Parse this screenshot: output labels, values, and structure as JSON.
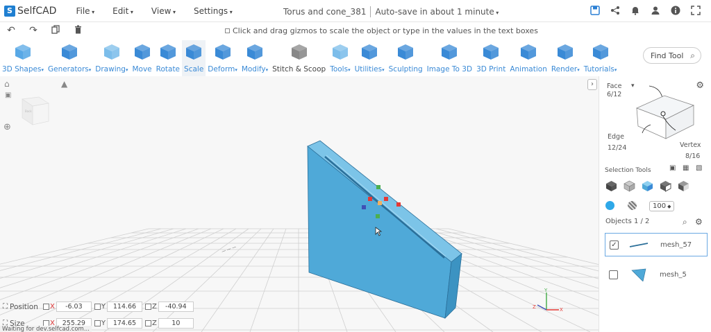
{
  "app": {
    "logo": "SelfCAD",
    "menus": [
      "File",
      "Edit",
      "View",
      "Settings"
    ],
    "doc_title": "Torus and cone_381",
    "autosave": "Auto-save in about 1 minute"
  },
  "hint": "Click and drag gizmos to scale the object or type in the values in the text boxes",
  "toolbar": [
    {
      "label": "3D Shapes",
      "drop": true,
      "color": "#58a8e6"
    },
    {
      "label": "Generators",
      "drop": true,
      "color": "#3a8ad6"
    },
    {
      "label": "Drawing",
      "drop": true,
      "color": "#7cbdea"
    },
    {
      "label": "Move",
      "drop": false,
      "color": "#3a8ad6"
    },
    {
      "label": "Rotate",
      "drop": false,
      "color": "#3a8ad6"
    },
    {
      "label": "Scale",
      "drop": false,
      "color": "#3a8ad6",
      "active": true
    },
    {
      "label": "Deform",
      "drop": true,
      "color": "#3a8ad6"
    },
    {
      "label": "Modify",
      "drop": true,
      "color": "#3a8ad6"
    },
    {
      "label": "Stitch & Scoop",
      "drop": false,
      "color": "#888888",
      "dark": true
    },
    {
      "label": "Tools",
      "drop": true,
      "color": "#7cbdea"
    },
    {
      "label": "Utilities",
      "drop": true,
      "color": "#3a8ad6"
    },
    {
      "label": "Sculpting",
      "drop": false,
      "color": "#3a8ad6"
    },
    {
      "label": "Image To 3D",
      "drop": false,
      "color": "#3a8ad6"
    },
    {
      "label": "3D Print",
      "drop": false,
      "color": "#3a8ad6"
    },
    {
      "label": "Animation",
      "drop": false,
      "color": "#3a8ad6"
    },
    {
      "label": "Render",
      "drop": true,
      "color": "#3a8ad6"
    },
    {
      "label": "Tutorials",
      "drop": true,
      "color": "#3a8ad6"
    }
  ],
  "find_tool": "Find Tool",
  "viewcube_label": "Back",
  "bottom": {
    "position_label": "Position",
    "size_label": "Size",
    "position": {
      "x": "-6.03",
      "y": "114.66",
      "z": "-40.94"
    },
    "size": {
      "x": "255.29",
      "y": "174.65",
      "z": "10"
    }
  },
  "status": "Waiting for dev.selfcad.com...",
  "right_panel": {
    "face": "Face",
    "face_count": "6/12",
    "edge": "Edge",
    "edge_count": "12/24",
    "vertex": "Vertex",
    "vertex_count": "8/16",
    "selection_tools": "Selection Tools",
    "zoom_value": "100",
    "objects_title": "Objects 1 / 2",
    "objects": [
      {
        "name": "mesh_57",
        "checked": true
      },
      {
        "name": "mesh_5",
        "checked": false
      }
    ]
  },
  "colors": {
    "accent": "#3a8ad6",
    "model": "#4fa9d8",
    "annotation": "#e02020"
  }
}
